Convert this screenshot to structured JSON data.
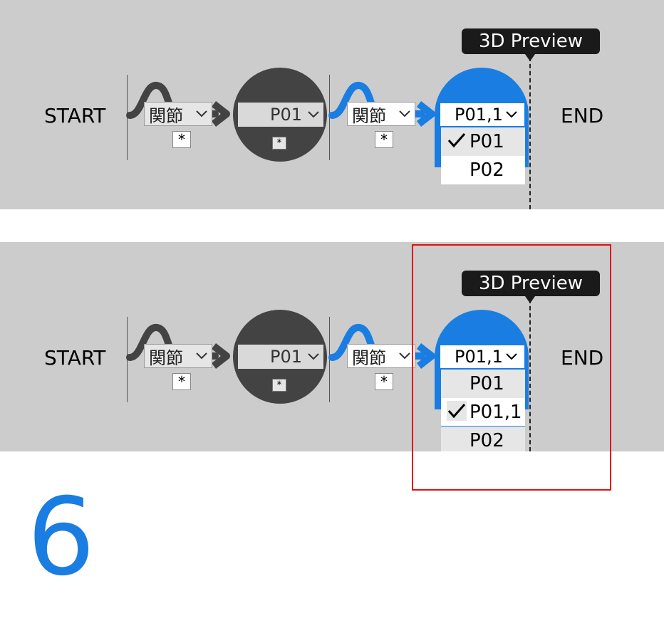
{
  "panels": [
    {
      "start_label": "START",
      "end_label": "END",
      "select1": "関節",
      "star1": "*",
      "node_value": "P01",
      "node_star": "*",
      "select2": "関節",
      "star2": "*",
      "blue_select": "P01,1",
      "badge": "3D Preview",
      "dropdown": [
        {
          "label": "P01",
          "checked": true
        },
        {
          "label": "P02",
          "checked": false
        }
      ]
    },
    {
      "start_label": "START",
      "end_label": "END",
      "select1": "関節",
      "star1": "*",
      "node_value": "P01",
      "node_star": "*",
      "select2": "関節",
      "star2": "*",
      "blue_select": "P01,1",
      "badge": "3D Preview",
      "dropdown": [
        {
          "label": "P01",
          "checked": false
        },
        {
          "label": "P01,1",
          "checked": true
        },
        {
          "label": "P02",
          "checked": false
        }
      ]
    }
  ],
  "step_number": "6",
  "colors": {
    "accent_blue": "#1a7de1",
    "dark_node": "#434343",
    "panel_bg": "#cccccc",
    "highlight": "#e01010"
  },
  "icons": [
    "chevron-down-icon",
    "checkmark-icon",
    "curve-arrow-icon"
  ]
}
